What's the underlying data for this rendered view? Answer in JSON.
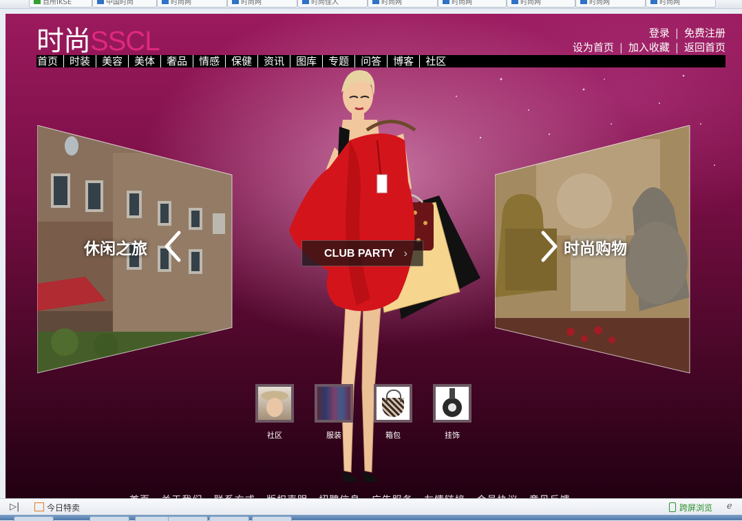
{
  "browser": {
    "tabs": [
      "百所IKSE",
      "中国时尚",
      "时尚网",
      "时尚网",
      "时尚佳人",
      "时尚网",
      "时尚网",
      "时尚网",
      "时尚网",
      "时尚网"
    ]
  },
  "site": {
    "logo_main": "时尚",
    "logo_accent": "SSCL",
    "top_links_row1": [
      "登录",
      "免费注册"
    ],
    "top_links_row2": [
      "设为首页",
      "加入收藏",
      "返回首页"
    ],
    "nav": [
      "首页",
      "时装",
      "美容",
      "美体",
      "奢品",
      "情感",
      "保健",
      "资讯",
      "图库",
      "专题",
      "问答",
      "博客",
      "社区"
    ]
  },
  "hero": {
    "left_label": "休闲之旅",
    "right_label": "时尚购物",
    "center_button": "CLUB PARTY",
    "thumbnails": [
      {
        "label": "社区",
        "icon": "woman-hat-photo"
      },
      {
        "label": "服装",
        "icon": "clothes-rack-photo"
      },
      {
        "label": "箱包",
        "icon": "handbag-photo"
      },
      {
        "label": "挂饰",
        "icon": "pendant-photo"
      }
    ],
    "footer_links": "首页 · 关于我们 · 联系方式 · 版权声明 · 招聘信息 · 广告服务 · 友情链接 · 会员协议 · 意见反馈"
  },
  "statusbar": {
    "deal_label": "今日特卖",
    "cross_screen": "跨屏浏览"
  },
  "colors": {
    "accent": "#e0287f",
    "bg_top": "#9b1a5e",
    "bg_bottom": "#220012",
    "dress": "#d4141b"
  }
}
